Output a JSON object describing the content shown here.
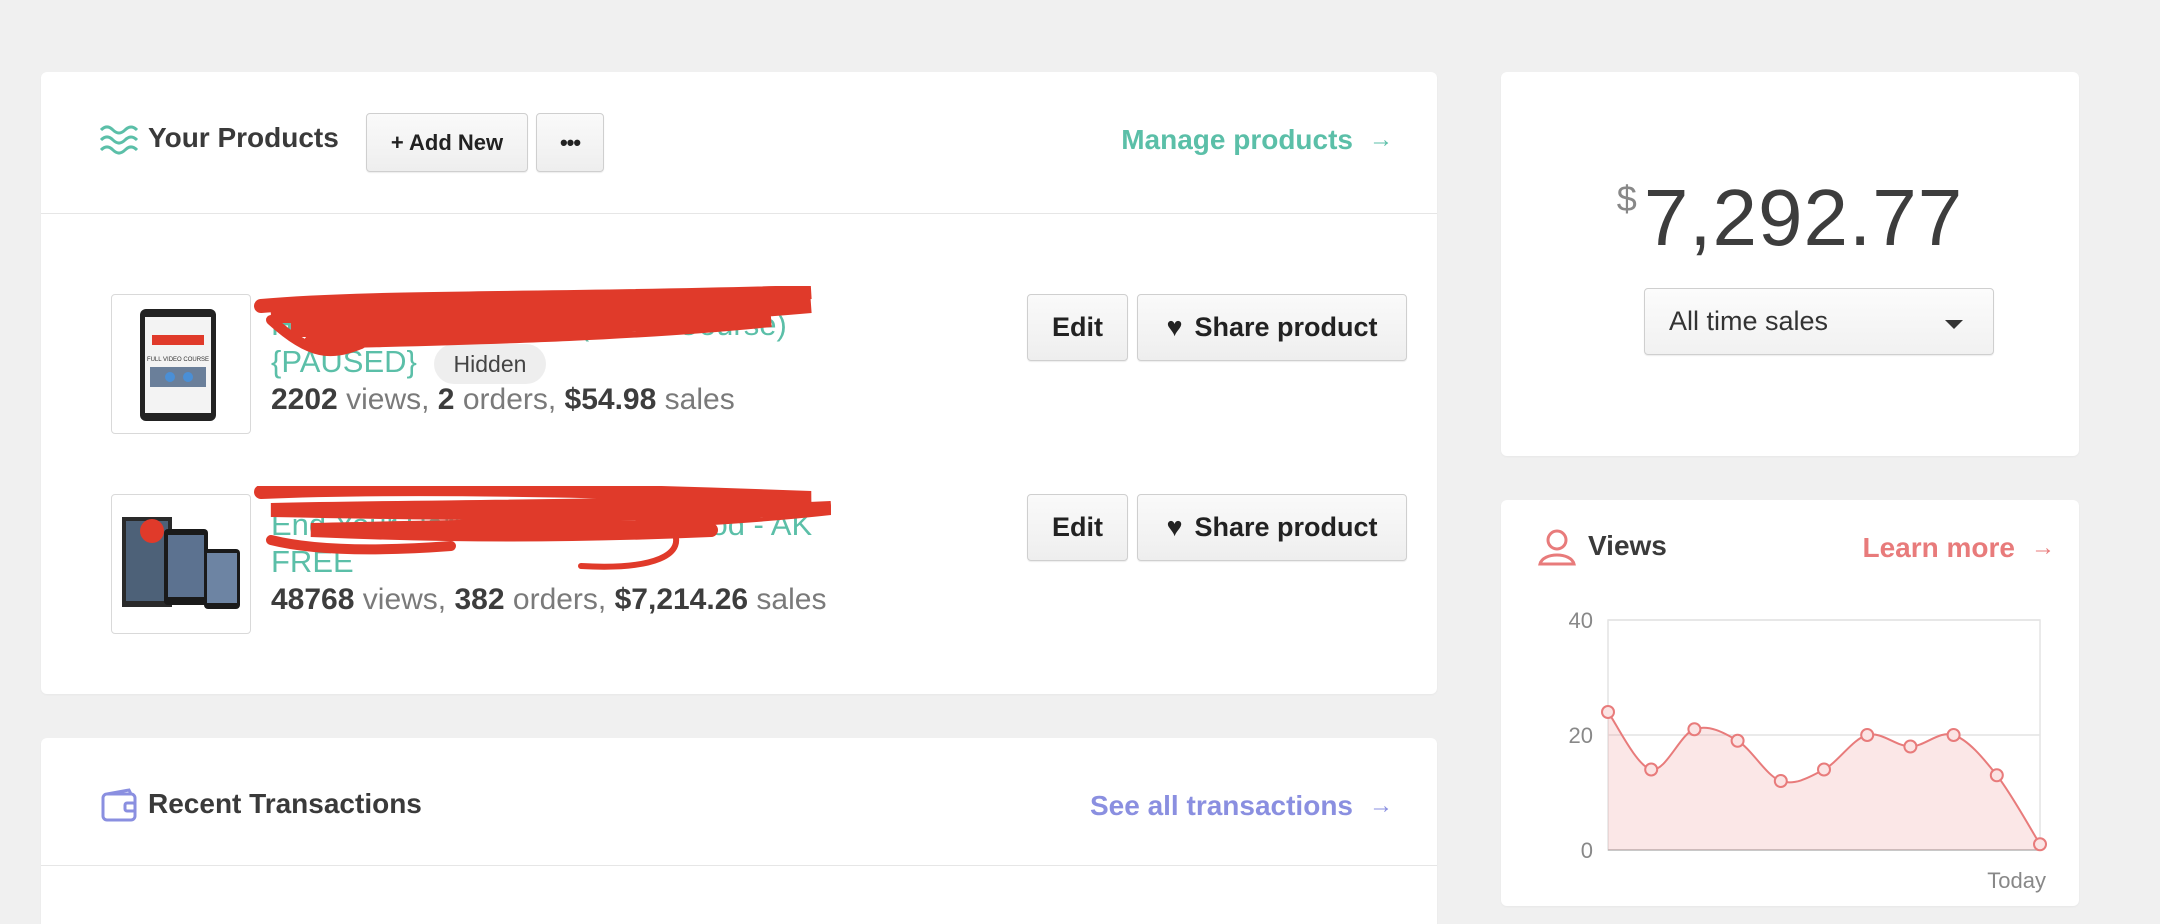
{
  "products": {
    "title": "Your Products",
    "add_new_label": "+ Add New",
    "more_label": "•••",
    "manage_label": "Manage products",
    "items": [
      {
        "name_line1": "How To Collect Leads (Video Course)",
        "name_line2": "{PAUSED}",
        "badge": "Hidden",
        "views": "2202",
        "orders": "2",
        "sales": "$54.98",
        "edit_label": "Edit",
        "share_label": "Share product"
      },
      {
        "name_line1": "End Your Porn Addiction For Good - AK",
        "name_line2": "FREE",
        "views": "48768",
        "orders": "382",
        "sales": "$7,214.26",
        "edit_label": "Edit",
        "share_label": "Share product"
      }
    ],
    "word_views": "views,",
    "word_orders": "orders,",
    "word_sales": "sales"
  },
  "transactions": {
    "title": "Recent Transactions",
    "link_label": "See all transactions"
  },
  "sales": {
    "currency": "$",
    "amount": "7,292.77",
    "period": "All time sales"
  },
  "views": {
    "title": "Views",
    "link_label": "Learn more"
  },
  "chart_data": {
    "type": "area",
    "x_last_label": "Today",
    "yticks": [
      0,
      20,
      40
    ],
    "ylim": [
      0,
      40
    ],
    "values": [
      24,
      14,
      21,
      19,
      12,
      14,
      20,
      18,
      20,
      13,
      1
    ],
    "grid": true,
    "color": "#e87b7b"
  },
  "colors": {
    "teal": "#5bbfa8",
    "purple": "#8a8fe0",
    "coral": "#e87b7b"
  }
}
